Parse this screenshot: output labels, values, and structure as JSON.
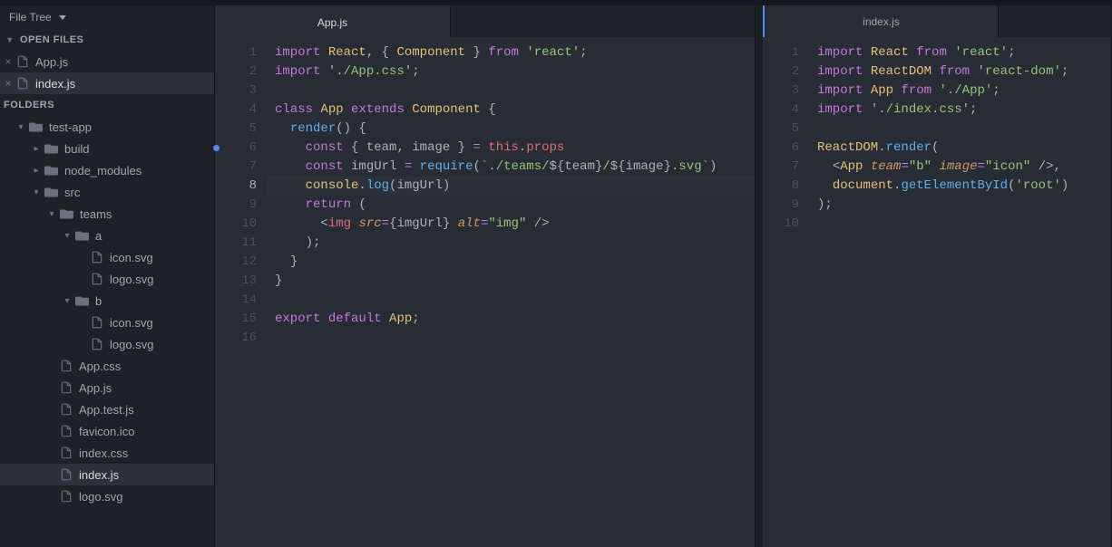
{
  "sidebar": {
    "title": "File Tree",
    "openFilesHeader": "OPEN FILES",
    "foldersHeader": "FOLDERS",
    "openFiles": [
      {
        "name": "App.js",
        "selected": false
      },
      {
        "name": "index.js",
        "selected": true
      }
    ],
    "tree": {
      "root": "test-app",
      "items": [
        {
          "depth": 0,
          "type": "folder",
          "chev": "down",
          "label": "test-app"
        },
        {
          "depth": 1,
          "type": "folder",
          "chev": "right",
          "label": "build"
        },
        {
          "depth": 1,
          "type": "folder",
          "chev": "right",
          "label": "node_modules"
        },
        {
          "depth": 1,
          "type": "folder",
          "chev": "down",
          "label": "src"
        },
        {
          "depth": 2,
          "type": "folder",
          "chev": "down",
          "label": "teams"
        },
        {
          "depth": 3,
          "type": "folder",
          "chev": "down",
          "label": "a"
        },
        {
          "depth": 4,
          "type": "file",
          "label": "icon.svg"
        },
        {
          "depth": 4,
          "type": "file",
          "label": "logo.svg"
        },
        {
          "depth": 3,
          "type": "folder",
          "chev": "down",
          "label": "b"
        },
        {
          "depth": 4,
          "type": "file",
          "label": "icon.svg"
        },
        {
          "depth": 4,
          "type": "file",
          "label": "logo.svg"
        },
        {
          "depth": 2,
          "type": "file",
          "label": "App.css"
        },
        {
          "depth": 2,
          "type": "file",
          "label": "App.js"
        },
        {
          "depth": 2,
          "type": "file",
          "label": "App.test.js"
        },
        {
          "depth": 2,
          "type": "file",
          "label": "favicon.ico"
        },
        {
          "depth": 2,
          "type": "file",
          "label": "index.css"
        },
        {
          "depth": 2,
          "type": "file",
          "label": "index.js",
          "selected": true
        },
        {
          "depth": 2,
          "type": "file",
          "label": "logo.svg"
        }
      ]
    }
  },
  "editors": {
    "left": {
      "tab": "App.js",
      "cursorLine": 8,
      "modifiedLine": 6,
      "lines": [
        [
          [
            "kw",
            "import"
          ],
          [
            "pl",
            " "
          ],
          [
            "cls",
            "React"
          ],
          [
            "pl",
            ", "
          ],
          [
            "pun",
            "{"
          ],
          [
            "pl",
            " "
          ],
          [
            "cls",
            "Component"
          ],
          [
            "pl",
            " "
          ],
          [
            "pun",
            "}"
          ],
          [
            "pl",
            " "
          ],
          [
            "kw",
            "from"
          ],
          [
            "pl",
            " "
          ],
          [
            "str",
            "'react'"
          ],
          [
            "pl",
            ";"
          ]
        ],
        [
          [
            "kw",
            "import"
          ],
          [
            "pl",
            " "
          ],
          [
            "str",
            "'./App.css'"
          ],
          [
            "pl",
            ";"
          ]
        ],
        [],
        [
          [
            "kw",
            "class"
          ],
          [
            "pl",
            " "
          ],
          [
            "cls",
            "App"
          ],
          [
            "pl",
            " "
          ],
          [
            "kw",
            "extends"
          ],
          [
            "pl",
            " "
          ],
          [
            "cls",
            "Component"
          ],
          [
            "pl",
            " "
          ],
          [
            "pun",
            "{"
          ]
        ],
        [
          [
            "pl",
            "  "
          ],
          [
            "fn",
            "render"
          ],
          [
            "pl",
            "()"
          ],
          [
            "pl",
            " "
          ],
          [
            "pun",
            "{"
          ]
        ],
        [
          [
            "pl",
            "    "
          ],
          [
            "kw",
            "const"
          ],
          [
            "pl",
            " "
          ],
          [
            "pun",
            "{"
          ],
          [
            "pl",
            " "
          ],
          [
            "pl",
            "team"
          ],
          [
            "pun",
            ","
          ],
          [
            "pl",
            " image "
          ],
          [
            "pun",
            "}"
          ],
          [
            "pl",
            " "
          ],
          [
            "kw",
            "="
          ],
          [
            "pl",
            " "
          ],
          [
            "red",
            "this"
          ],
          [
            "pl",
            "."
          ],
          [
            "red",
            "props"
          ]
        ],
        [
          [
            "pl",
            "    "
          ],
          [
            "kw",
            "const"
          ],
          [
            "pl",
            " "
          ],
          [
            "pl",
            "imgUrl"
          ],
          [
            "pl",
            " "
          ],
          [
            "kw",
            "="
          ],
          [
            "pl",
            " "
          ],
          [
            "fn",
            "require"
          ],
          [
            "pl",
            "("
          ],
          [
            "str",
            "`./teams/"
          ],
          [
            "pun",
            "${"
          ],
          [
            "pl",
            "team"
          ],
          [
            "pun",
            "}"
          ],
          [
            "str",
            "/"
          ],
          [
            "pun",
            "${"
          ],
          [
            "pl",
            "image"
          ],
          [
            "pun",
            "}"
          ],
          [
            "str",
            ".svg`"
          ],
          [
            "pl",
            ")"
          ]
        ],
        [
          [
            "pl",
            "    "
          ],
          [
            "cls",
            "console"
          ],
          [
            "pl",
            "."
          ],
          [
            "fn",
            "log"
          ],
          [
            "pl",
            "("
          ],
          [
            "pl",
            "imgUrl"
          ],
          [
            "pl",
            ")"
          ]
        ],
        [
          [
            "pl",
            "    "
          ],
          [
            "kw",
            "return"
          ],
          [
            "pl",
            " ("
          ]
        ],
        [
          [
            "pl",
            "      "
          ],
          [
            "pun",
            "<"
          ],
          [
            "red",
            "img"
          ],
          [
            "pl",
            " "
          ],
          [
            "prm attr",
            "src"
          ],
          [
            "kw",
            "="
          ],
          [
            "pun",
            "{"
          ],
          [
            "pl",
            "imgUrl"
          ],
          [
            "pun",
            "}"
          ],
          [
            "pl",
            " "
          ],
          [
            "prm attr",
            "alt"
          ],
          [
            "kw",
            "="
          ],
          [
            "str",
            "\"img\""
          ],
          [
            "pl",
            " "
          ],
          [
            "pun",
            "/>"
          ]
        ],
        [
          [
            "pl",
            "    );"
          ]
        ],
        [
          [
            "pl",
            "  "
          ],
          [
            "pun",
            "}"
          ]
        ],
        [
          [
            "pun",
            "}"
          ]
        ],
        [],
        [
          [
            "kw",
            "export"
          ],
          [
            "pl",
            " "
          ],
          [
            "kw",
            "default"
          ],
          [
            "pl",
            " "
          ],
          [
            "cls",
            "App"
          ],
          [
            "pl",
            ";"
          ]
        ],
        []
      ]
    },
    "right": {
      "tab": "index.js",
      "lines": [
        [
          [
            "kw",
            "import"
          ],
          [
            "pl",
            " "
          ],
          [
            "cls",
            "React"
          ],
          [
            "pl",
            " "
          ],
          [
            "kw",
            "from"
          ],
          [
            "pl",
            " "
          ],
          [
            "str",
            "'react'"
          ],
          [
            "pl",
            ";"
          ]
        ],
        [
          [
            "kw",
            "import"
          ],
          [
            "pl",
            " "
          ],
          [
            "cls",
            "ReactDOM"
          ],
          [
            "pl",
            " "
          ],
          [
            "kw",
            "from"
          ],
          [
            "pl",
            " "
          ],
          [
            "str",
            "'react-dom'"
          ],
          [
            "pl",
            ";"
          ]
        ],
        [
          [
            "kw",
            "import"
          ],
          [
            "pl",
            " "
          ],
          [
            "cls",
            "App"
          ],
          [
            "pl",
            " "
          ],
          [
            "kw",
            "from"
          ],
          [
            "pl",
            " "
          ],
          [
            "str",
            "'./App'"
          ],
          [
            "pl",
            ";"
          ]
        ],
        [
          [
            "kw",
            "import"
          ],
          [
            "pl",
            " "
          ],
          [
            "str",
            "'./index.css'"
          ],
          [
            "pl",
            ";"
          ]
        ],
        [],
        [
          [
            "cls",
            "ReactDOM"
          ],
          [
            "pl",
            "."
          ],
          [
            "fn",
            "render"
          ],
          [
            "pl",
            "("
          ]
        ],
        [
          [
            "pl",
            "  "
          ],
          [
            "pun",
            "<"
          ],
          [
            "cls",
            "App"
          ],
          [
            "pl",
            " "
          ],
          [
            "prm attr",
            "team"
          ],
          [
            "kw",
            "="
          ],
          [
            "str",
            "\"b\""
          ],
          [
            "pl",
            " "
          ],
          [
            "prm attr",
            "image"
          ],
          [
            "kw",
            "="
          ],
          [
            "str",
            "\"icon\""
          ],
          [
            "pl",
            " "
          ],
          [
            "pun",
            "/>"
          ],
          [
            "pl",
            ","
          ]
        ],
        [
          [
            "pl",
            "  "
          ],
          [
            "cls",
            "document"
          ],
          [
            "pl",
            "."
          ],
          [
            "fn",
            "getElementById"
          ],
          [
            "pl",
            "("
          ],
          [
            "str",
            "'root'"
          ],
          [
            "pl",
            ")"
          ]
        ],
        [
          [
            "pl",
            ");"
          ]
        ],
        []
      ]
    }
  }
}
